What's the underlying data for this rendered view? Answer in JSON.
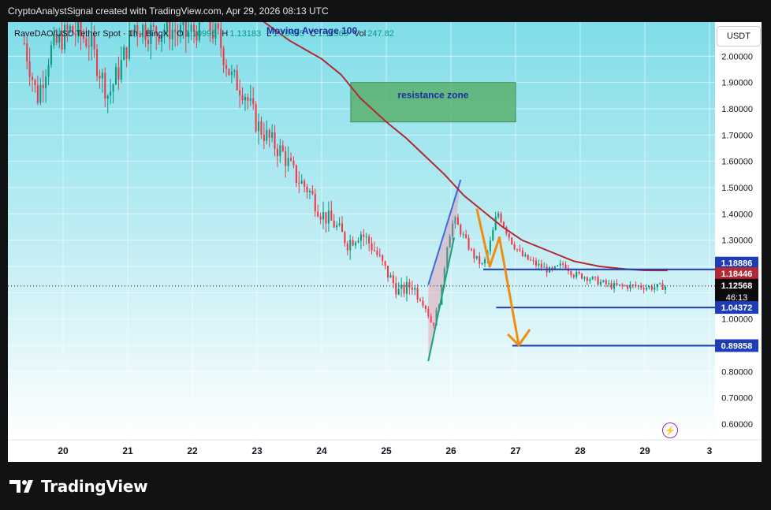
{
  "header": {
    "credit": "CryptoAnalystSignal created with TradingView.com, Apr 29, 2026 08:13 UTC"
  },
  "legend": {
    "symbol": "RaveDAO/USD Tether Spot · 1h · BingX",
    "o_label": "O",
    "o_value": "1.10995",
    "h_label": "H",
    "h_value": "1.13183",
    "l_label": "L",
    "l_value": "1.10695",
    "c_label": "C",
    "c_value": "1.11568",
    "vol_label": "Vol",
    "vol_value": "247.82",
    "ma_label": "Moving Average 100"
  },
  "unit_button": "USDT",
  "branding": {
    "name": "TradingView"
  },
  "countdown": "46:13",
  "colors": {
    "bg_top": "#7fdde9",
    "bg_bottom": "#ffffff",
    "up": "#089981",
    "down": "#f23645",
    "ma": "#b22833",
    "level": "#1e3cb4",
    "arrow": "#f08c14",
    "wedge": "#3d6ae0",
    "zone": "#5bb06e",
    "zone_text": "#1e2d9c",
    "axis_text": "#131722",
    "label_blue": "#1e3cb4",
    "label_red": "#b22833",
    "label_black": "#0b0b0b"
  },
  "chart_data": {
    "type": "candlestick",
    "title": "",
    "xlabel": "",
    "ylabel": "",
    "x_ticks": [
      "20",
      "21",
      "22",
      "23",
      "24",
      "25",
      "26",
      "27",
      "28",
      "29",
      "3"
    ],
    "y_ticks": [
      "0.60000",
      "0.70000",
      "0.80000",
      "0.90000",
      "1.00000",
      "1.10000",
      "1.20000",
      "1.30000",
      "1.40000",
      "1.50000",
      "1.60000",
      "1.70000",
      "1.80000",
      "1.90000",
      "2.00000"
    ],
    "ylim": [
      0.54,
      2.13
    ],
    "grid": true,
    "current_price": 1.12568,
    "series": [
      {
        "name": "Moving Average 100",
        "points": [
          [
            22.3,
            2.25
          ],
          [
            23.0,
            2.15
          ],
          [
            23.5,
            2.06
          ],
          [
            24.0,
            1.99
          ],
          [
            24.3,
            1.93
          ],
          [
            24.6,
            1.84
          ],
          [
            25.0,
            1.75
          ],
          [
            25.3,
            1.69
          ],
          [
            25.6,
            1.62
          ],
          [
            25.9,
            1.55
          ],
          [
            26.2,
            1.47
          ],
          [
            26.5,
            1.41
          ],
          [
            26.8,
            1.35
          ],
          [
            27.1,
            1.3
          ],
          [
            27.5,
            1.26
          ],
          [
            27.9,
            1.22
          ],
          [
            28.3,
            1.2
          ],
          [
            28.7,
            1.19
          ],
          [
            29.0,
            1.185
          ],
          [
            29.35,
            1.1845
          ]
        ]
      }
    ],
    "path": [
      [
        19.4,
        2.05
      ],
      [
        19.6,
        1.84
      ],
      [
        19.8,
        2.02
      ],
      [
        20.1,
        2.1
      ],
      [
        20.4,
        2.06
      ],
      [
        20.7,
        1.85
      ],
      [
        20.9,
        1.97
      ],
      [
        21.1,
        2.12
      ],
      [
        21.4,
        2.09
      ],
      [
        21.6,
        2.11
      ],
      [
        21.9,
        2.08
      ],
      [
        22.2,
        2.13
      ],
      [
        22.4,
        2.07
      ],
      [
        22.6,
        1.92
      ],
      [
        22.8,
        1.87
      ],
      [
        23.0,
        1.74
      ],
      [
        23.2,
        1.68
      ],
      [
        23.4,
        1.63
      ],
      [
        23.6,
        1.54
      ],
      [
        23.8,
        1.49
      ],
      [
        24.0,
        1.4
      ],
      [
        24.2,
        1.36
      ],
      [
        24.4,
        1.29
      ],
      [
        24.6,
        1.33
      ],
      [
        24.8,
        1.27
      ],
      [
        25.0,
        1.18
      ],
      [
        25.2,
        1.1
      ],
      [
        25.4,
        1.13
      ],
      [
        25.6,
        1.05
      ],
      [
        25.72,
        0.97
      ],
      [
        25.85,
        1.1
      ],
      [
        25.95,
        1.3
      ],
      [
        26.05,
        1.38
      ],
      [
        26.2,
        1.31
      ],
      [
        26.35,
        1.24
      ],
      [
        26.5,
        1.2
      ],
      [
        26.62,
        1.3
      ],
      [
        26.72,
        1.41
      ],
      [
        26.85,
        1.34
      ],
      [
        26.95,
        1.29
      ],
      [
        27.1,
        1.24
      ],
      [
        27.3,
        1.21
      ],
      [
        27.55,
        1.18
      ],
      [
        27.75,
        1.21
      ],
      [
        27.9,
        1.17
      ],
      [
        28.1,
        1.16
      ],
      [
        28.3,
        1.14
      ],
      [
        28.5,
        1.125
      ],
      [
        28.7,
        1.125
      ],
      [
        28.9,
        1.125
      ],
      [
        29.1,
        1.12
      ],
      [
        29.35,
        1.125
      ]
    ],
    "levels": [
      {
        "value": 1.18886,
        "label": "1.18886",
        "x0": 26.5
      },
      {
        "value": 1.04372,
        "label": "1.04372",
        "x0": 26.7
      },
      {
        "value": 0.89858,
        "label": "0.89858",
        "x0": 26.95
      }
    ],
    "price_labels": [
      {
        "value": 1.18886,
        "label": "1.18886",
        "style": "blue"
      },
      {
        "value": 1.18446,
        "label": "1.18446",
        "style": "red"
      },
      {
        "value": 1.12568,
        "label": "1.12568",
        "style": "black"
      },
      {
        "value": 1.04372,
        "label": "1.04372",
        "style": "blue"
      },
      {
        "value": 0.89858,
        "label": "0.89858",
        "style": "blue"
      }
    ],
    "annotations": [
      {
        "type": "zone",
        "text": "resistance zone",
        "x0": 24.45,
        "x1": 27.0,
        "y0": 1.75,
        "y1": 1.9
      },
      {
        "type": "rising_wedge",
        "upper": [
          [
            25.65,
            1.13
          ],
          [
            26.15,
            1.53
          ]
        ],
        "lower": [
          [
            25.65,
            0.84
          ],
          [
            26.05,
            1.31
          ]
        ]
      },
      {
        "type": "projection_arrow",
        "points": [
          [
            26.4,
            1.42
          ],
          [
            26.6,
            1.2
          ],
          [
            26.75,
            1.31
          ],
          [
            27.05,
            0.9
          ]
        ]
      }
    ]
  }
}
